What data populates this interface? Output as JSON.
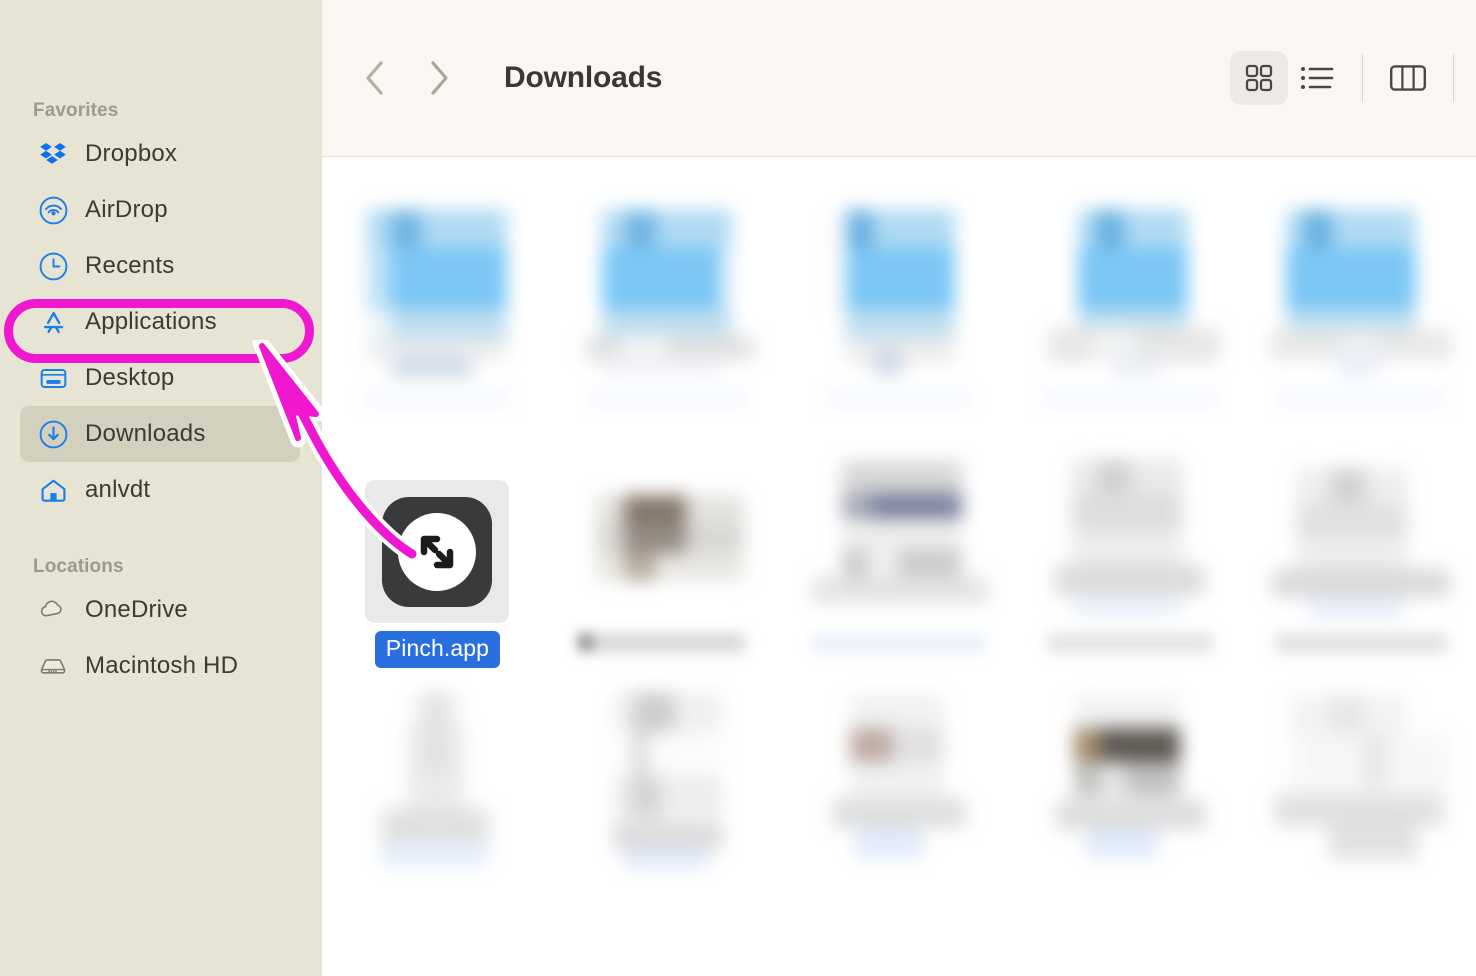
{
  "window": {
    "app": "Finder",
    "accent_highlight": "#ef17cf",
    "sidebar_bg": "#e8e4d3",
    "toolbar_bg": "#faf6f1",
    "selection_blue": "#2a6fe0"
  },
  "sidebar": {
    "sections": [
      {
        "title": "Favorites",
        "items": [
          {
            "label": "Dropbox",
            "icon": "dropbox-icon",
            "selected": false,
            "highlighted": false
          },
          {
            "label": "AirDrop",
            "icon": "airdrop-icon",
            "selected": false,
            "highlighted": false
          },
          {
            "label": "Recents",
            "icon": "clock-icon",
            "selected": false,
            "highlighted": false
          },
          {
            "label": "Applications",
            "icon": "app-store-icon",
            "selected": false,
            "highlighted": true
          },
          {
            "label": "Desktop",
            "icon": "desktop-icon",
            "selected": false,
            "highlighted": false
          },
          {
            "label": "Downloads",
            "icon": "download-icon",
            "selected": true,
            "highlighted": false
          },
          {
            "label": "anlvdt",
            "icon": "home-icon",
            "selected": false,
            "highlighted": false
          }
        ]
      },
      {
        "title": "Locations",
        "items": [
          {
            "label": "OneDrive",
            "icon": "cloud-icon",
            "selected": false,
            "highlighted": false
          },
          {
            "label": "Macintosh HD",
            "icon": "hard-drive-icon",
            "selected": false,
            "highlighted": false
          }
        ]
      }
    ]
  },
  "toolbar": {
    "back_icon": "chevron-left-icon",
    "forward_icon": "chevron-right-icon",
    "title": "Downloads",
    "views": [
      {
        "name": "icon-view",
        "icon": "grid-icon",
        "active": true
      },
      {
        "name": "list-view",
        "icon": "list-icon",
        "active": false
      },
      {
        "name": "column-view",
        "icon": "columns-icon",
        "active": false
      }
    ]
  },
  "files": {
    "rows": [
      [
        {
          "name": "",
          "kind": "redacted",
          "thumb": "blue-doc",
          "selected": false
        },
        {
          "name": "",
          "kind": "redacted",
          "thumb": "blue-doc",
          "selected": false
        },
        {
          "name": "",
          "kind": "redacted",
          "thumb": "blue-doc",
          "selected": false
        },
        {
          "name": "",
          "kind": "redacted",
          "thumb": "blue-doc",
          "selected": false
        },
        {
          "name": "",
          "kind": "redacted",
          "thumb": "blue-doc",
          "selected": false
        }
      ],
      [
        {
          "name": "Pinch.app",
          "kind": "application",
          "thumb": "pinch-app-icon",
          "selected": true
        },
        {
          "name": "",
          "kind": "redacted",
          "thumb": "gray-wide",
          "selected": false
        },
        {
          "name": "",
          "kind": "redacted",
          "thumb": "gray-tall-blue",
          "selected": false
        },
        {
          "name": "",
          "kind": "redacted",
          "thumb": "gray-tall",
          "selected": false
        },
        {
          "name": "",
          "kind": "redacted",
          "thumb": "gray-tall",
          "selected": false
        }
      ],
      [
        {
          "name": "",
          "kind": "redacted",
          "thumb": "gray-narrow",
          "selected": false
        },
        {
          "name": "",
          "kind": "redacted",
          "thumb": "gray-doc",
          "selected": false
        },
        {
          "name": "",
          "kind": "redacted",
          "thumb": "brown-doc",
          "selected": false
        },
        {
          "name": "",
          "kind": "redacted",
          "thumb": "dark-doc",
          "selected": false
        },
        {
          "name": "",
          "kind": "redacted",
          "thumb": "pale-doc",
          "selected": false
        }
      ]
    ]
  },
  "annotations": {
    "highlight_target": "Applications",
    "arrow": "curved-arrow-pointing-up-left",
    "color": "#ef17cf"
  }
}
